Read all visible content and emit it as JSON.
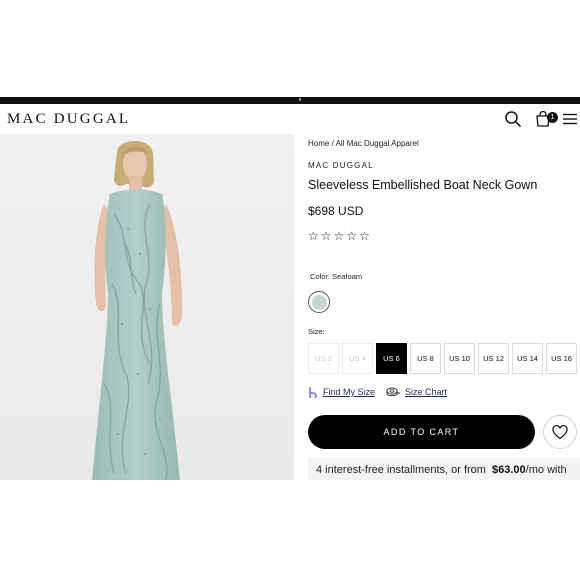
{
  "header": {
    "logo": "MAC DUGGAL",
    "icons": [
      "search-icon",
      "bag-icon",
      "menu-icon"
    ],
    "cart_count": "1"
  },
  "breadcrumb": {
    "home": "Home",
    "separator": "/",
    "current": "All Mac Duggal Apparel"
  },
  "product": {
    "brand": "MAC DUGGAL",
    "title": "Sleeveless Embellished Boat Neck Gown",
    "price": "$698 USD",
    "rating": 0,
    "rating_max": 5,
    "color_label": "Color: Seafoam",
    "swatch_color": "#c5d6d0",
    "size_label": "Size:",
    "sizes": [
      {
        "label": "US 2",
        "state": "disabled"
      },
      {
        "label": "US 4",
        "state": "disabled"
      },
      {
        "label": "US 6",
        "state": "selected"
      },
      {
        "label": "US 8",
        "state": "available"
      },
      {
        "label": "US 10",
        "state": "available"
      },
      {
        "label": "US 12",
        "state": "available"
      },
      {
        "label": "US 14",
        "state": "available"
      },
      {
        "label": "US 16",
        "state": "available"
      }
    ],
    "find_my_size": "Find My Size",
    "size_chart": "Size Chart",
    "add_to_cart": "ADD TO CART",
    "installments_prefix": "4 interest-free installments, or from",
    "installments_amount": "$63.00",
    "installments_suffix": "/mo with"
  },
  "colors": {
    "accent": "#000000",
    "link": "#1d2a5c",
    "dress": "#a9c6c1",
    "background": "#efefef"
  }
}
